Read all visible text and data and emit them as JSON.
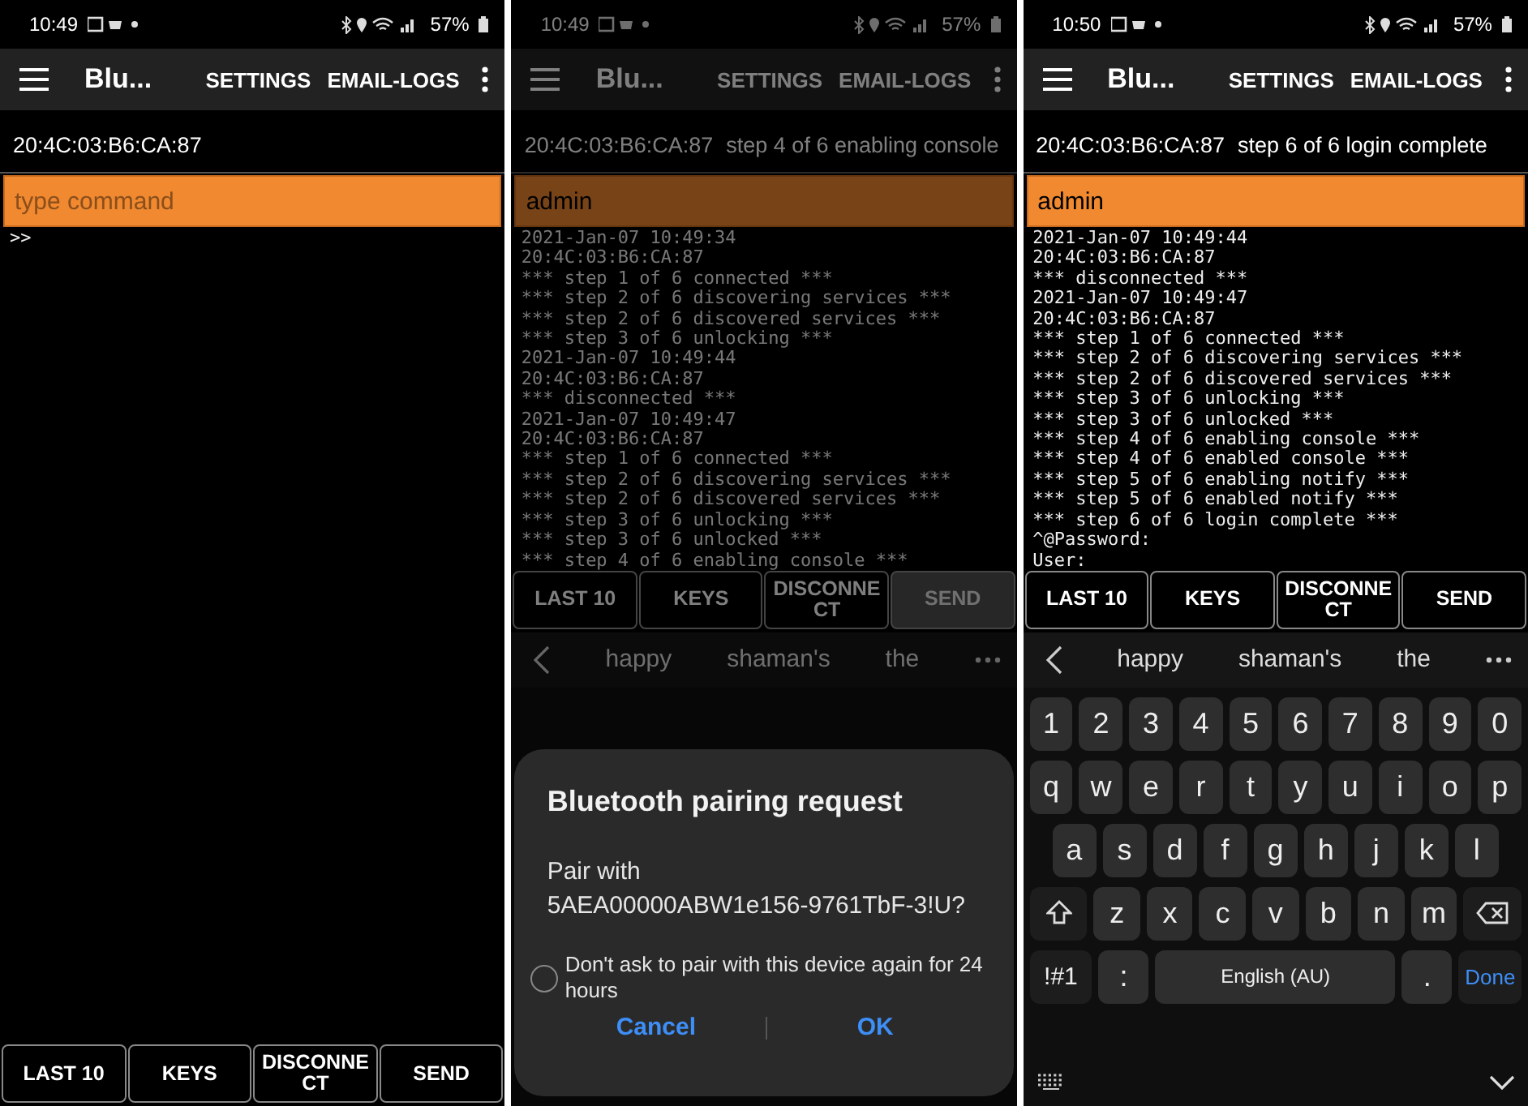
{
  "screens": [
    {
      "dimmed": false,
      "status_bar": {
        "time": "10:49",
        "battery": "57%"
      },
      "toolbar": {
        "title": "Blu...",
        "actions": [
          "SETTINGS",
          "EMAIL-LOGS"
        ]
      },
      "device": {
        "address": "20:4C:03:B6:CA:87"
      },
      "command": {
        "placeholder": "type command"
      },
      "log": [
        ">>"
      ],
      "buttons": [
        {
          "label": "LAST 10",
          "disabled": false
        },
        {
          "label": "KEYS",
          "disabled": false
        },
        {
          "label": "DISCONNECT",
          "disabled": false
        },
        {
          "label": "SEND",
          "disabled": false
        }
      ]
    },
    {
      "dimmed": true,
      "status_bar": {
        "time": "10:49",
        "battery": "57%"
      },
      "toolbar": {
        "title": "Blu...",
        "actions": [
          "SETTINGS",
          "EMAIL-LOGS"
        ]
      },
      "device": {
        "address": "20:4C:03:B6:CA:87",
        "status": "step 4 of 6 enabling console"
      },
      "command": {
        "value": "admin"
      },
      "log": [
        "2021-Jan-07 10:49:34",
        "20:4C:03:B6:CA:87",
        "*** step 1 of 6 connected ***",
        "*** step 2 of 6 discovering services ***",
        "*** step 2 of 6 discovered services ***",
        "*** step 3 of 6 unlocking ***",
        "2021-Jan-07 10:49:44",
        "20:4C:03:B6:CA:87",
        "*** disconnected ***",
        "2021-Jan-07 10:49:47",
        "20:4C:03:B6:CA:87",
        "*** step 1 of 6 connected ***",
        "*** step 2 of 6 discovering services ***",
        "*** step 2 of 6 discovered services ***",
        "*** step 3 of 6 unlocking ***",
        "*** step 3 of 6 unlocked ***",
        "*** step 4 of 6 enabling console ***"
      ],
      "buttons": [
        {
          "label": "LAST 10",
          "disabled": false
        },
        {
          "label": "KEYS",
          "disabled": false
        },
        {
          "label": "DISCONNECT",
          "disabled": false
        },
        {
          "label": "SEND",
          "disabled": true
        }
      ],
      "keyboard": {
        "suggestions": [
          "happy",
          "shaman's",
          "the"
        ]
      },
      "dialog": {
        "title": "Bluetooth pairing request",
        "message": "Pair with",
        "device": "5AEA00000ABW1e156-9761TbF-3!U?",
        "option": {
          "label": "Don't ask to pair with this device again for 24 hours",
          "checked": false
        },
        "buttons": [
          "Cancel",
          "OK"
        ]
      }
    },
    {
      "dimmed": false,
      "status_bar": {
        "time": "10:50",
        "battery": "57%"
      },
      "toolbar": {
        "title": "Blu...",
        "actions": [
          "SETTINGS",
          "EMAIL-LOGS"
        ]
      },
      "device": {
        "address": "20:4C:03:B6:CA:87",
        "status": "step 6 of 6 login complete"
      },
      "command": {
        "value": "admin"
      },
      "log": [
        "2021-Jan-07 10:49:44",
        "20:4C:03:B6:CA:87",
        "*** disconnected ***",
        "2021-Jan-07 10:49:47",
        "20:4C:03:B6:CA:87",
        "*** step 1 of 6 connected ***",
        "*** step 2 of 6 discovering services ***",
        "*** step 2 of 6 discovered services ***",
        "*** step 3 of 6 unlocking ***",
        "*** step 3 of 6 unlocked ***",
        "*** step 4 of 6 enabling console ***",
        "*** step 4 of 6 enabled console ***",
        "*** step 5 of 6 enabling notify ***",
        "*** step 5 of 6 enabled notify ***",
        "*** step 6 of 6 login complete ***",
        "^@Password:",
        "User:"
      ],
      "buttons": [
        {
          "label": "LAST 10",
          "disabled": false
        },
        {
          "label": "KEYS",
          "disabled": false
        },
        {
          "label": "DISCONNECT",
          "disabled": false
        },
        {
          "label": "SEND",
          "disabled": false
        }
      ],
      "keyboard": {
        "suggestions": [
          "happy",
          "shaman's",
          "the"
        ],
        "rows": [
          {
            "keys": [
              {
                "kind": "char",
                "label": "1"
              },
              {
                "kind": "char",
                "label": "2"
              },
              {
                "kind": "char",
                "label": "3"
              },
              {
                "kind": "char",
                "label": "4"
              },
              {
                "kind": "char",
                "label": "5"
              },
              {
                "kind": "char",
                "label": "6"
              },
              {
                "kind": "char",
                "label": "7"
              },
              {
                "kind": "char",
                "label": "8"
              },
              {
                "kind": "char",
                "label": "9"
              },
              {
                "kind": "char",
                "label": "0"
              }
            ]
          },
          {
            "keys": [
              {
                "kind": "char",
                "label": "q"
              },
              {
                "kind": "char",
                "label": "w"
              },
              {
                "kind": "char",
                "label": "e"
              },
              {
                "kind": "char",
                "label": "r"
              },
              {
                "kind": "char",
                "label": "t"
              },
              {
                "kind": "char",
                "label": "y"
              },
              {
                "kind": "char",
                "label": "u"
              },
              {
                "kind": "char",
                "label": "i"
              },
              {
                "kind": "char",
                "label": "o"
              },
              {
                "kind": "char",
                "label": "p"
              }
            ]
          },
          {
            "keys": [
              {
                "kind": "char",
                "label": "a"
              },
              {
                "kind": "char",
                "label": "s"
              },
              {
                "kind": "char",
                "label": "d"
              },
              {
                "kind": "char",
                "label": "f"
              },
              {
                "kind": "char",
                "label": "g"
              },
              {
                "kind": "char",
                "label": "h"
              },
              {
                "kind": "char",
                "label": "j"
              },
              {
                "kind": "char",
                "label": "k"
              },
              {
                "kind": "char",
                "label": "l"
              }
            ]
          },
          {
            "keys": [
              {
                "kind": "shift"
              },
              {
                "kind": "char",
                "label": "z"
              },
              {
                "kind": "char",
                "label": "x"
              },
              {
                "kind": "char",
                "label": "c"
              },
              {
                "kind": "char",
                "label": "v"
              },
              {
                "kind": "char",
                "label": "b"
              },
              {
                "kind": "char",
                "label": "n"
              },
              {
                "kind": "char",
                "label": "m"
              },
              {
                "kind": "backspace"
              }
            ]
          },
          {
            "keys": [
              {
                "kind": "symbols",
                "label": "!#1"
              },
              {
                "kind": "char",
                "label": ":"
              },
              {
                "kind": "space",
                "label": "English (AU)"
              },
              {
                "kind": "char",
                "label": "."
              },
              {
                "kind": "done",
                "label": "Done"
              }
            ]
          }
        ]
      }
    }
  ]
}
